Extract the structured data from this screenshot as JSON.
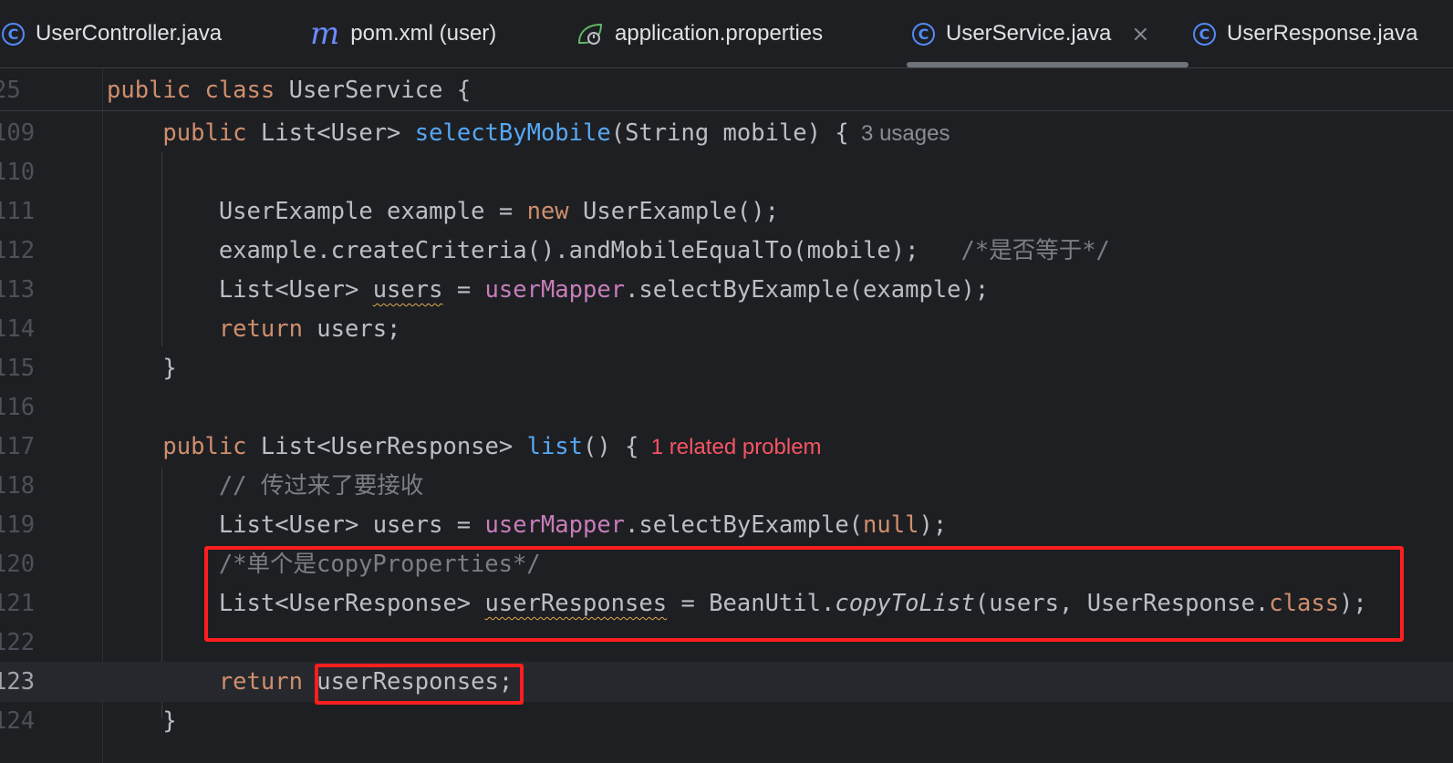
{
  "tabs": [
    {
      "label": "UserController.java",
      "icon": "class-icon",
      "active": false
    },
    {
      "label": "pom.xml (user)",
      "icon": "maven-icon",
      "active": false
    },
    {
      "label": "application.properties",
      "icon": "spring-leaf-icon",
      "active": false
    },
    {
      "label": "UserService.java",
      "icon": "class-icon",
      "active": true,
      "close": "×"
    },
    {
      "label": "UserResponse.java",
      "icon": "class-icon",
      "active": false
    }
  ],
  "lines": [
    {
      "n": "25",
      "parts": [
        [
          "kw",
          "public class "
        ],
        [
          "",
          "UserService {"
        ]
      ]
    },
    {
      "n": "109",
      "parts": [
        [
          "kw",
          "    public "
        ],
        [
          "",
          "List<User> "
        ],
        [
          "fn",
          "selectByMobile"
        ],
        [
          "",
          "(String mobile) {"
        ]
      ],
      "hint": "3 usages"
    },
    {
      "n": "110",
      "parts": []
    },
    {
      "n": "111",
      "parts": [
        [
          "",
          "        UserExample example = "
        ],
        [
          "kw",
          "new "
        ],
        [
          "",
          "UserExample();"
        ]
      ]
    },
    {
      "n": "112",
      "parts": [
        [
          "",
          "        example.createCriteria().andMobileEqualTo(mobile);   "
        ],
        [
          "cmt",
          "/*是否等于*/"
        ]
      ]
    },
    {
      "n": "113",
      "parts": [
        [
          "",
          "        List<User> "
        ],
        [
          "squig",
          "users"
        ],
        [
          "",
          " = "
        ],
        [
          "fld",
          "userMapper"
        ],
        [
          "",
          ".selectByExample(example);"
        ]
      ]
    },
    {
      "n": "114",
      "parts": [
        [
          "kw",
          "        return "
        ],
        [
          "",
          "users;"
        ]
      ]
    },
    {
      "n": "115",
      "parts": [
        [
          "",
          "    }"
        ]
      ]
    },
    {
      "n": "116",
      "parts": []
    },
    {
      "n": "117",
      "parts": [
        [
          "kw",
          "    public "
        ],
        [
          "",
          "List<UserResponse> "
        ],
        [
          "fn",
          "list"
        ],
        [
          "",
          "() {"
        ]
      ],
      "problem": "1 related problem"
    },
    {
      "n": "118",
      "parts": [
        [
          "cmt",
          "        // 传过来了要接收"
        ]
      ]
    },
    {
      "n": "119",
      "parts": [
        [
          "",
          "        List<User> users = "
        ],
        [
          "fld",
          "userMapper"
        ],
        [
          "",
          ".selectByExample("
        ],
        [
          "kw",
          "null"
        ],
        [
          "",
          ");"
        ]
      ]
    },
    {
      "n": "120",
      "parts": [
        [
          "cmt",
          "        /*单个是copyProperties*/"
        ]
      ]
    },
    {
      "n": "121",
      "parts": [
        [
          "",
          "        List<UserResponse> "
        ],
        [
          "squig",
          "userResponses"
        ],
        [
          "",
          " = BeanUtil."
        ],
        [
          "it",
          "copyToList"
        ],
        [
          "",
          "(users, UserResponse."
        ],
        [
          "kw",
          "class"
        ],
        [
          "",
          ");"
        ]
      ]
    },
    {
      "n": "122",
      "parts": []
    },
    {
      "n": "123",
      "parts": [
        [
          "kw",
          "        return "
        ],
        [
          "",
          "userResponses;"
        ]
      ],
      "current": true
    },
    {
      "n": "124",
      "parts": [
        [
          "",
          "    }"
        ]
      ]
    }
  ]
}
